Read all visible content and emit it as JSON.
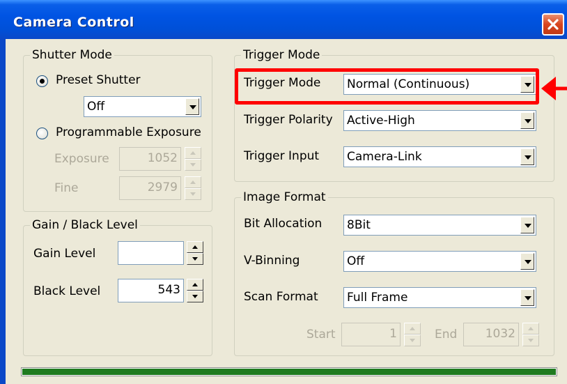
{
  "window": {
    "title": "Camera Control",
    "close_icon": "close-icon"
  },
  "shutter_mode": {
    "legend": "Shutter Mode",
    "preset_label": "Preset Shutter",
    "preset_selected": true,
    "preset_value": "Off",
    "programmable_label": "Programmable Exposure",
    "exposure_label": "Exposure",
    "exposure_value": "1052",
    "fine_label": "Fine",
    "fine_value": "2979"
  },
  "gain_black": {
    "legend": "Gain / Black Level",
    "gain_label": "Gain Level",
    "gain_value": "",
    "black_label": "Black Level",
    "black_value": "543"
  },
  "trigger_mode": {
    "legend": "Trigger Mode",
    "mode_label": "Trigger Mode",
    "mode_value": "Normal (Continuous)",
    "polarity_label": "Trigger Polarity",
    "polarity_value": "Active-High",
    "input_label": "Trigger Input",
    "input_value": "Camera-Link"
  },
  "image_format": {
    "legend": "Image Format",
    "bit_label": "Bit Allocation",
    "bit_value": "8Bit",
    "vbin_label": "V-Binning",
    "vbin_value": "Off",
    "scan_label": "Scan Format",
    "scan_value": "Full Frame",
    "start_label": "Start",
    "start_value": "1",
    "end_label": "End",
    "end_value": "1032"
  },
  "progress": {
    "fraction": 1.0,
    "color": "#1f7b1f"
  },
  "annotation": {
    "color": "#ff0000"
  }
}
